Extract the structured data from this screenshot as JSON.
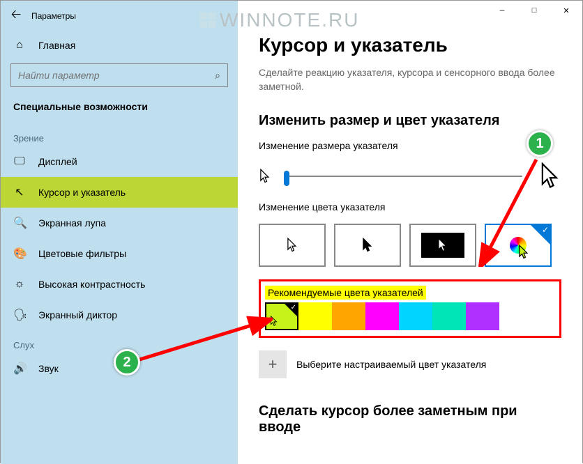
{
  "app_title": "Параметры",
  "watermark": "WINNOTE.RU",
  "window_buttons": {
    "min": "—",
    "max": "□",
    "close": "✕"
  },
  "sidebar": {
    "home": "Главная",
    "search_placeholder": "Найти параметр",
    "category": "Специальные возможности",
    "group_vision": "Зрение",
    "group_hearing": "Слух",
    "items_vision": [
      {
        "icon": "display-icon",
        "label": "Дисплей"
      },
      {
        "icon": "pointer-icon",
        "label": "Курсор и указатель"
      },
      {
        "icon": "magnifier-icon",
        "label": "Экранная лупа"
      },
      {
        "icon": "color-filters-icon",
        "label": "Цветовые фильтры"
      },
      {
        "icon": "contrast-icon",
        "label": "Высокая контрастность"
      },
      {
        "icon": "narrator-icon",
        "label": "Экранный диктор"
      }
    ],
    "items_hearing": [
      {
        "icon": "sound-icon",
        "label": "Звук"
      }
    ]
  },
  "main": {
    "title": "Курсор и указатель",
    "desc": "Сделайте реакцию указателя, курсора и сенсорного ввода более заметной.",
    "size_section": "Изменить размер и цвет указателя",
    "size_label": "Изменение размера указателя",
    "color_label": "Изменение цвета указателя",
    "rec_title": "Рекомендуемые цвета указателей",
    "custom_label": "Выберите настраиваемый цвет указателя",
    "caret_section": "Сделать курсор более заметным при вводе"
  },
  "color_options": [
    {
      "name": "pointer-white"
    },
    {
      "name": "pointer-black"
    },
    {
      "name": "pointer-inverted"
    },
    {
      "name": "pointer-custom",
      "selected": true
    }
  ],
  "swatches": [
    {
      "hex": "#c6f41a",
      "selected": true
    },
    {
      "hex": "#ffff00"
    },
    {
      "hex": "#ffa500"
    },
    {
      "hex": "#ff00ff"
    },
    {
      "hex": "#00d4ff"
    },
    {
      "hex": "#00e5b8"
    },
    {
      "hex": "#b030ff"
    }
  ],
  "callouts": {
    "c1": "1",
    "c2": "2"
  }
}
